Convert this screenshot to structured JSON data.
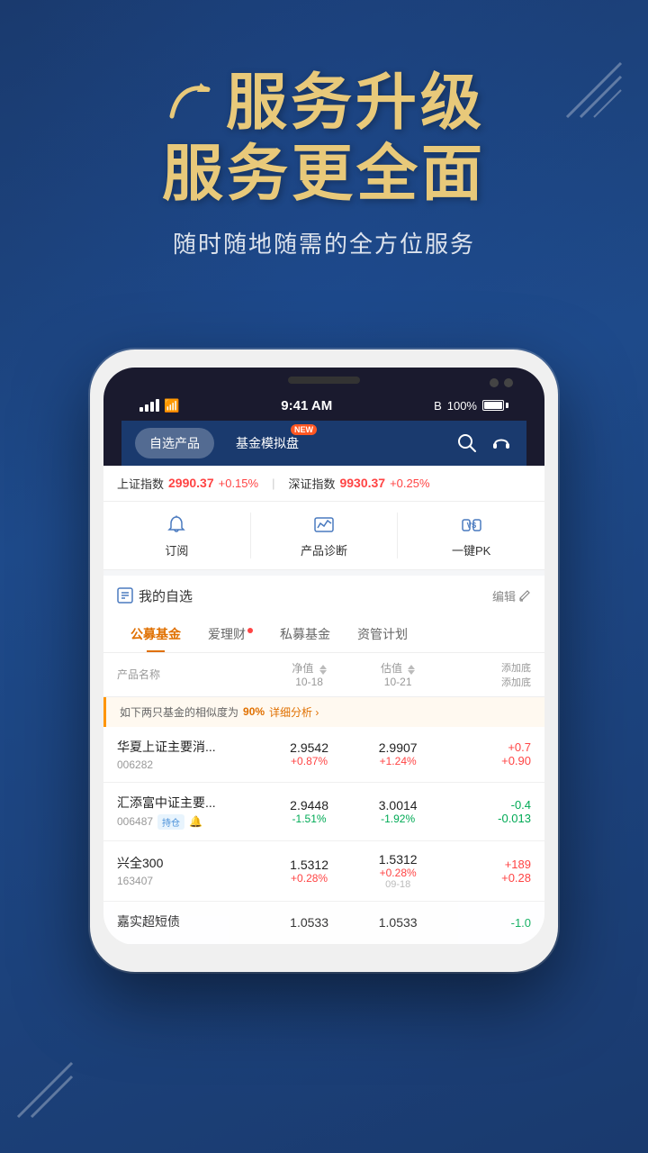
{
  "hero": {
    "title_line1": "服务升级",
    "title_line2": "服务更全面",
    "subtitle": "随时随地随需的全方位服务"
  },
  "phone": {
    "status": {
      "time": "9:41 AM",
      "battery": "100%",
      "bluetooth": "bluetooth"
    },
    "nav": {
      "tab1": "自选产品",
      "tab2": "基金模拟盘",
      "new_badge": "NEW"
    },
    "ticker": {
      "index1_name": "上证指数",
      "index1_value": "2990.37",
      "index1_change": "+0.15%",
      "index2_name": "深证指数",
      "index2_value": "9930.37",
      "index2_change": "+0.25%"
    },
    "actions": [
      {
        "label": "订阅",
        "icon": "bell-icon"
      },
      {
        "label": "产品诊断",
        "icon": "chart-icon"
      },
      {
        "label": "一键PK",
        "icon": "vs-icon"
      }
    ],
    "watchlist": {
      "title": "我的自选",
      "edit": "编辑"
    },
    "tabs": [
      {
        "label": "公募基金",
        "active": true
      },
      {
        "label": "爱理财",
        "dot": true
      },
      {
        "label": "私募基金"
      },
      {
        "label": "资管计划"
      }
    ],
    "table_header": {
      "name": "产品名称",
      "nav": "净值",
      "nav_date": "10-18",
      "est": "估值",
      "est_date": "10-21",
      "add": "添加底",
      "add2": "添加底"
    },
    "alert": {
      "text": "如下两只基金的相似度为",
      "percent": "90%",
      "link": "详细分析 ›"
    },
    "funds": [
      {
        "name": "华夏上证主要消...",
        "code": "006282",
        "tag": null,
        "bell": false,
        "nav_val": "2.9542",
        "nav_change": "+0.87%",
        "nav_change_type": "red",
        "est_val": "2.9907",
        "est_change": "+1.24%",
        "est_change_type": "red",
        "add_val": "+0.7",
        "add_val2": "+0.90",
        "add_type": "red"
      },
      {
        "name": "汇添富中证主要...",
        "code": "006487",
        "tag": "持仓",
        "bell": true,
        "nav_val": "2.9448",
        "nav_change": "-1.51%",
        "nav_change_type": "green",
        "est_val": "3.0014",
        "est_change": "-1.92%",
        "est_change_type": "green",
        "add_val": "-0.4",
        "add_val2": "-0.013",
        "add_type": "green"
      },
      {
        "name": "兴全300",
        "code": "163407",
        "tag": null,
        "bell": false,
        "nav_val": "1.5312",
        "nav_change": "+0.28%",
        "nav_change_type": "red",
        "est_val": "1.5312",
        "est_change": "+0.28%",
        "est_change_type": "red",
        "date2": "09-18",
        "add_val": "+189",
        "add_val2": "+0.28",
        "add_type": "red"
      },
      {
        "name": "嘉实超短债",
        "code": "",
        "tag": null,
        "bell": false,
        "nav_val": "1.0533",
        "nav_change": "",
        "nav_change_type": "red",
        "est_val": "1.0533",
        "est_change": "",
        "est_change_type": "red",
        "add_val": "-1.0",
        "add_val2": "",
        "add_type": "green"
      }
    ]
  }
}
